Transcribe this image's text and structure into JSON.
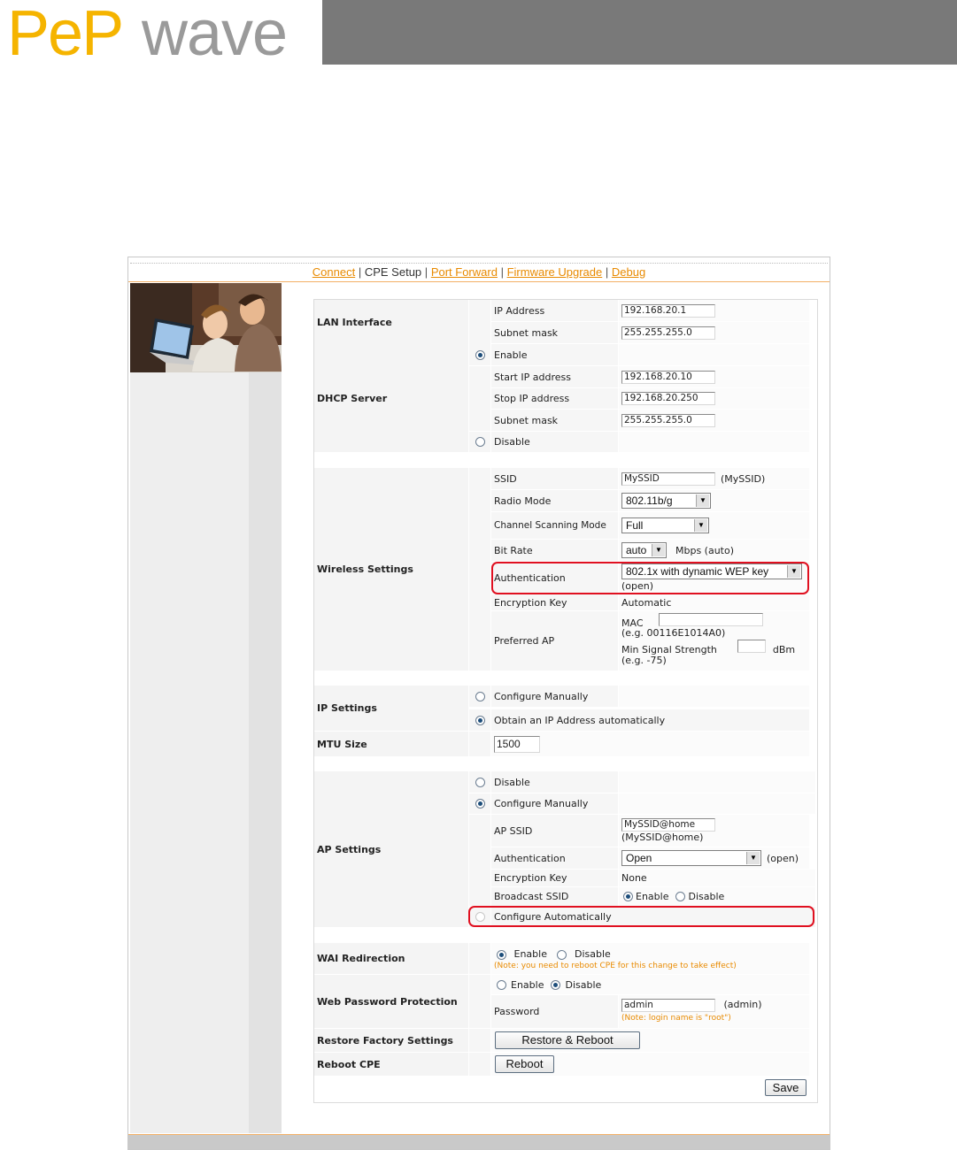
{
  "logo": {
    "left": "PeP",
    "right": "wave"
  },
  "nav": {
    "connect": "Connect",
    "cpe_setup": "CPE Setup",
    "port_forward": "Port Forward",
    "firmware_upgrade": "Firmware Upgrade",
    "debug": "Debug",
    "separator": "|"
  },
  "lan": {
    "title": "LAN Interface",
    "ip_label": "IP Address",
    "ip_value": "192.168.20.1",
    "mask_label": "Subnet mask",
    "mask_value": "255.255.255.0"
  },
  "dhcp": {
    "title": "DHCP Server",
    "enable": "Enable",
    "start_label": "Start IP address",
    "start_value": "192.168.20.10",
    "stop_label": "Stop IP address",
    "stop_value": "192.168.20.250",
    "mask_label": "Subnet mask",
    "mask_value": "255.255.255.0",
    "disable": "Disable"
  },
  "wireless": {
    "title": "Wireless Settings",
    "ssid_label": "SSID",
    "ssid_value": "MySSID",
    "ssid_hint": "(MySSID)",
    "radio_label": "Radio Mode",
    "radio_value": "802.11b/g",
    "channel_label": "Channel Scanning Mode",
    "channel_value": "Full",
    "bitrate_label": "Bit Rate",
    "bitrate_value": "auto",
    "bitrate_hint": "Mbps (auto)",
    "auth_label": "Authentication",
    "auth_value": "802.1x with dynamic WEP key",
    "auth_hint": "(open)",
    "enc_label": "Encryption Key",
    "enc_value": "Automatic",
    "pref_label": "Preferred AP",
    "mac_label": "MAC",
    "mac_example": "(e.g. 00116E1014A0)",
    "signal_label": "Min Signal Strength",
    "signal_unit": "dBm",
    "signal_example": "(e.g. -75)"
  },
  "ip": {
    "title": "IP Settings",
    "manual": "Configure Manually",
    "auto": "Obtain an IP Address automatically"
  },
  "mtu": {
    "title": "MTU Size",
    "value": "1500"
  },
  "ap": {
    "title": "AP Settings",
    "disable": "Disable",
    "manual": "Configure Manually",
    "ssid_label": "AP SSID",
    "ssid_value": "MySSID@home",
    "ssid_hint": "(MySSID@home)",
    "auth_label": "Authentication",
    "auth_value": "Open",
    "auth_hint": "(open)",
    "enc_label": "Encryption Key",
    "enc_value": "None",
    "bcast_label": "Broadcast SSID",
    "bcast_enable": "Enable",
    "bcast_disable": "Disable",
    "auto": "Configure Automatically"
  },
  "wai": {
    "title": "WAI Redirection",
    "enable": "Enable",
    "disable": "Disable",
    "note": "(Note: you need to reboot CPE for this change to take effect)"
  },
  "webpw": {
    "title": "Web Password Protection",
    "enable": "Enable",
    "disable": "Disable",
    "pw_label": "Password",
    "pw_value": "admin",
    "pw_hint": "(admin)",
    "note": "(Note: login name is \"root\")"
  },
  "restore": {
    "title": "Restore Factory Settings",
    "button": "Restore & Reboot"
  },
  "reboot": {
    "title": "Reboot CPE",
    "button": "Reboot"
  },
  "save": "Save",
  "colors": {
    "brand_yellow": "#f5b400",
    "link_orange": "#e88a00",
    "highlight_red": "#e01020",
    "header_gray": "#797979"
  }
}
